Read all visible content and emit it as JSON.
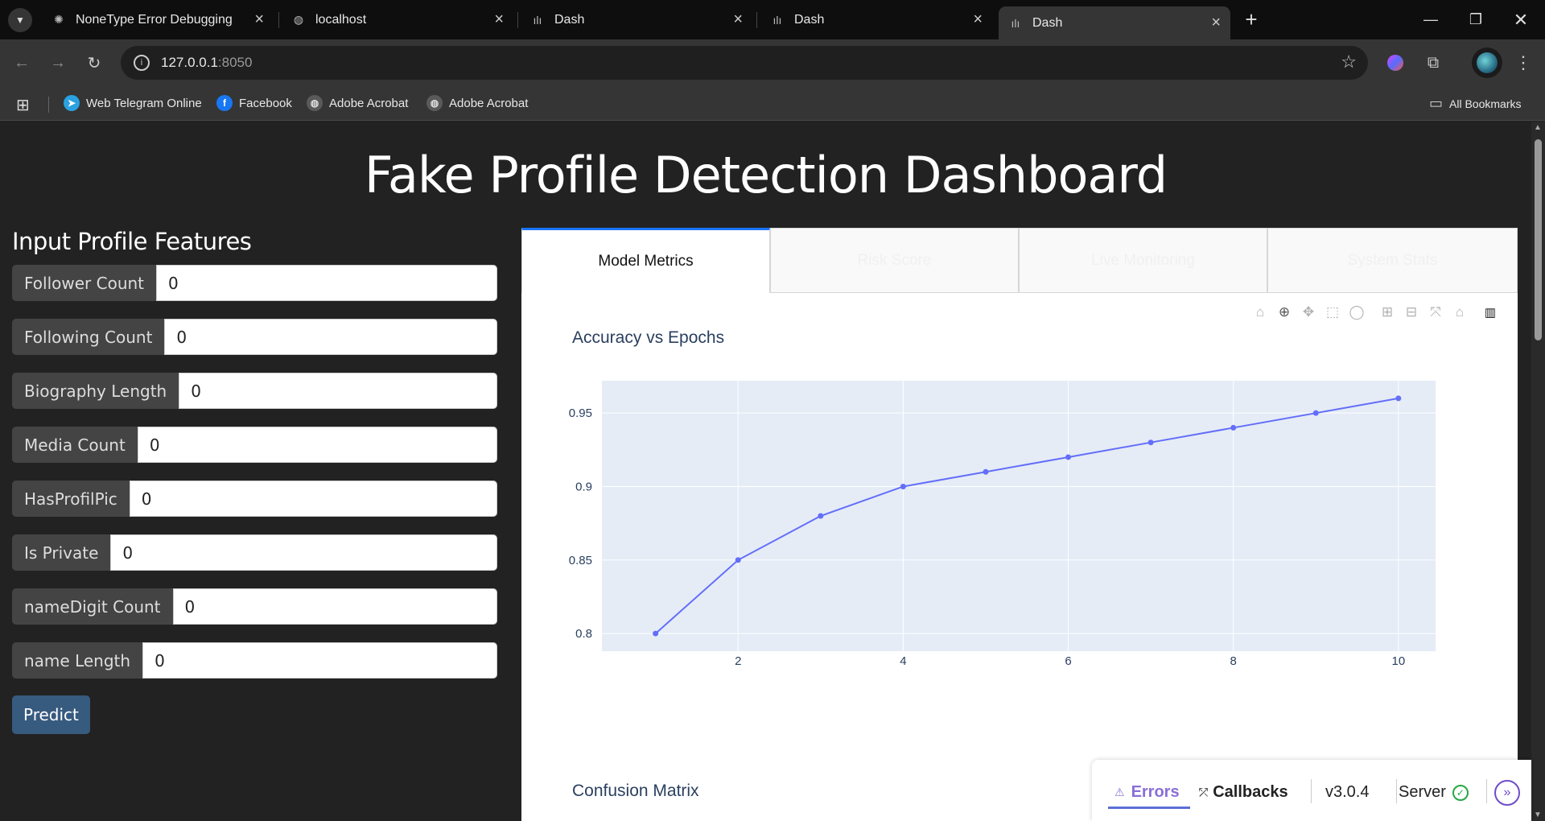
{
  "browser": {
    "tabs": [
      {
        "title": "NoneType Error Debugging",
        "icon": "openai-icon"
      },
      {
        "title": "localhost",
        "icon": "globe-icon"
      },
      {
        "title": "Dash",
        "icon": "dash-icon"
      },
      {
        "title": "Dash",
        "icon": "dash-icon"
      },
      {
        "title": "Dash",
        "icon": "dash-icon",
        "active": true
      }
    ],
    "url_host": "127.0.0.1",
    "url_port": ":8050",
    "bookmarks": [
      {
        "label": "Web Telegram Online",
        "icon": "telegram-icon"
      },
      {
        "label": "Facebook",
        "icon": "facebook-icon"
      },
      {
        "label": "Adobe Acrobat",
        "icon": "globe-icon"
      },
      {
        "label": "Adobe Acrobat",
        "icon": "globe-icon"
      }
    ],
    "all_bookmarks": "All Bookmarks"
  },
  "page": {
    "title": "Fake Profile Detection Dashboard",
    "form_title": "Input Profile Features",
    "fields": [
      {
        "label": "Follower Count",
        "value": "0"
      },
      {
        "label": "Following Count",
        "value": "0"
      },
      {
        "label": "Biography Length",
        "value": "0"
      },
      {
        "label": "Media Count",
        "value": "0"
      },
      {
        "label": "HasProfilPic",
        "value": "0"
      },
      {
        "label": "Is Private",
        "value": "0"
      },
      {
        "label": "nameDigit Count",
        "value": "0"
      },
      {
        "label": "name Length",
        "value": "0"
      }
    ],
    "predict_label": "Predict",
    "tabs": [
      "Model Metrics",
      "Risk Score",
      "Live Monitoring",
      "System Stats"
    ],
    "second_chart_title": "Confusion Matrix"
  },
  "chart_data": {
    "type": "line",
    "title": "Accuracy vs Epochs",
    "xlabel": "",
    "ylabel": "",
    "x": [
      1,
      2,
      3,
      4,
      5,
      6,
      7,
      8,
      9,
      10
    ],
    "y": [
      0.8,
      0.85,
      0.88,
      0.9,
      0.91,
      0.92,
      0.93,
      0.94,
      0.95,
      0.96
    ],
    "xticks": [
      2,
      4,
      6,
      8,
      10
    ],
    "yticks": [
      0.8,
      0.85,
      0.9,
      0.95
    ],
    "ytick_labels": [
      "0.8",
      "0.85",
      "0.9",
      "0.95"
    ],
    "xlim": [
      0.35,
      10.45
    ],
    "ylim": [
      0.788,
      0.972
    ],
    "line_color": "#636efa",
    "plot_bg": "#e5ecf6",
    "grid": true
  },
  "debug_bar": {
    "errors": "Errors",
    "callbacks": "Callbacks",
    "version": "v3.0.4",
    "server": "Server"
  }
}
